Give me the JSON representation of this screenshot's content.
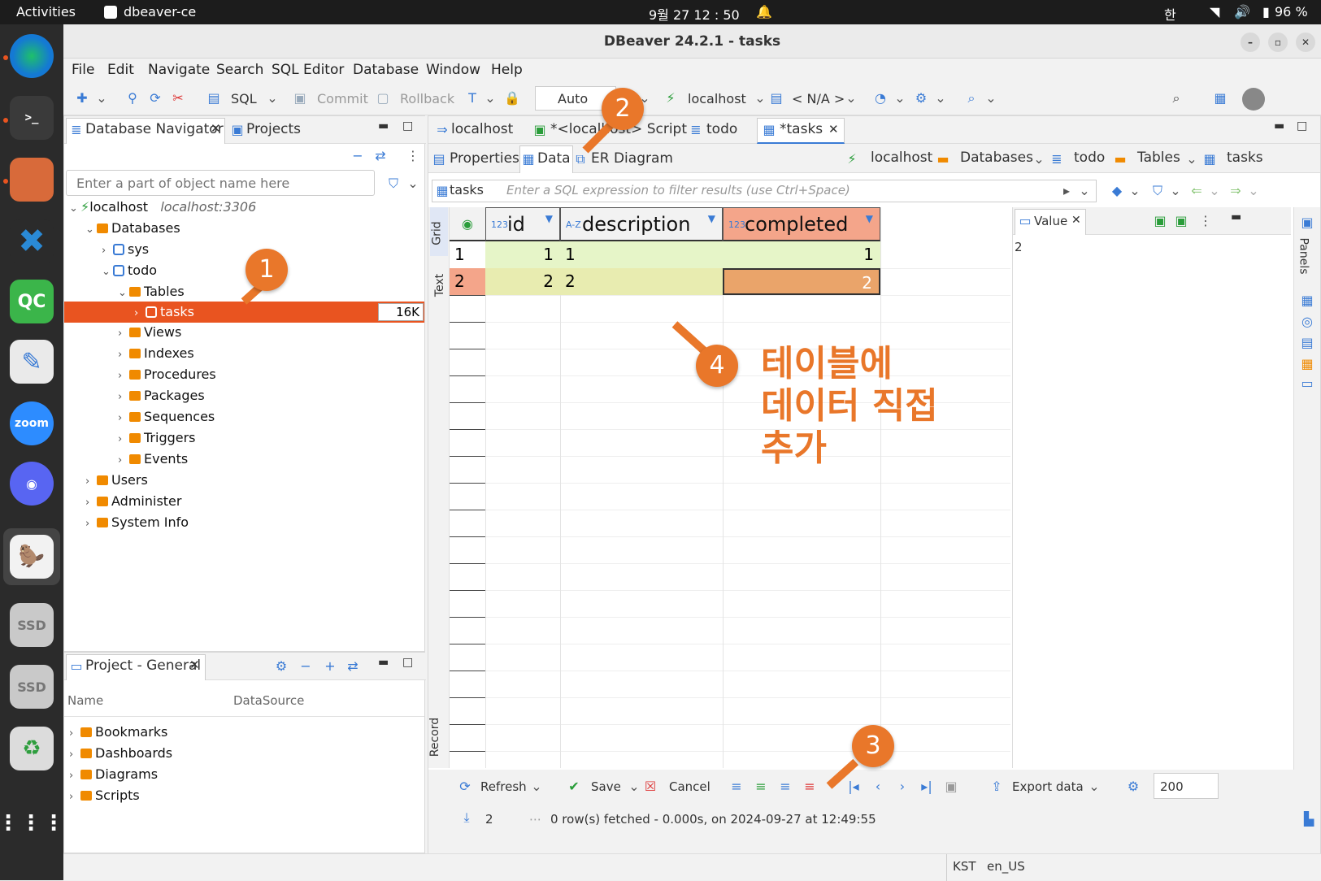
{
  "system_bar": {
    "activities": "Activities",
    "app_name": "dbeaver-ce",
    "clock": "9월 27  12 : 50",
    "ime": "한",
    "battery": "96 %"
  },
  "window": {
    "title": "DBeaver 24.2.1 - tasks"
  },
  "menu": [
    "File",
    "Edit",
    "Navigate",
    "Search",
    "SQL Editor",
    "Database",
    "Window",
    "Help"
  ],
  "toolbar": {
    "sql": "SQL",
    "commit": "Commit",
    "rollback": "Rollback",
    "auto": "Auto",
    "connection": "localhost",
    "schema": "< N/A >"
  },
  "navigator": {
    "tab1": "Database Navigator",
    "tab2": "Projects",
    "filter_placeholder": "Enter a part of object name here",
    "conn_name": "localhost",
    "conn_addr": "localhost:3306",
    "databases": "Databases",
    "sys": "sys",
    "todo": "todo",
    "tables": "Tables",
    "tasks": "tasks",
    "tasks_size": "16K",
    "children": [
      "Views",
      "Indexes",
      "Procedures",
      "Packages",
      "Sequences",
      "Triggers",
      "Events"
    ],
    "roots": [
      "Users",
      "Administer",
      "System Info"
    ]
  },
  "project": {
    "tab": "Project - General",
    "col_name": "Name",
    "col_ds": "DataSource",
    "items": [
      "Bookmarks",
      "Dashboards",
      "Diagrams",
      "Scripts"
    ]
  },
  "editor_tabs": [
    "localhost",
    "*<localhost> Script",
    "todo",
    "*tasks"
  ],
  "sub_tabs": [
    "Properties",
    "Data",
    "ER Diagram"
  ],
  "breadcrumb": [
    "localhost",
    "Databases",
    "todo",
    "Tables",
    "tasks"
  ],
  "filter": {
    "table_label": "tasks",
    "placeholder": "Enter a SQL expression to filter results (use Ctrl+Space)"
  },
  "side_tabs": {
    "grid": "Grid",
    "text": "Text",
    "record": "Record",
    "panels": "Panels"
  },
  "columns": [
    {
      "type": "123",
      "name": "id"
    },
    {
      "type": "A-Z",
      "name": "description"
    },
    {
      "type": "123",
      "name": "completed"
    }
  ],
  "rows": [
    {
      "num": "1",
      "id": "1",
      "description": "1",
      "completed": "1"
    },
    {
      "num": "2",
      "id": "2",
      "description": "2",
      "completed": "2"
    }
  ],
  "value_panel": {
    "title": "Value",
    "content": "2"
  },
  "bottom": {
    "refresh": "Refresh",
    "save": "Save",
    "cancel": "Cancel",
    "export": "Export data",
    "fetch_size": "200",
    "row_count": "2",
    "status": "0 row(s) fetched - 0.000s, on 2024-09-27 at 12:49:55"
  },
  "statusbar": {
    "tz": "KST",
    "locale": "en_US"
  },
  "annotations": {
    "c1": "1",
    "c2": "2",
    "c3": "3",
    "c4": "4",
    "text": "테이블에\n데이터 직접\n추가"
  },
  "colors": {
    "accent": "#e9772a",
    "selection": "#e95420",
    "new_row": "#e6f5c8",
    "modified": "#eaa46a"
  }
}
